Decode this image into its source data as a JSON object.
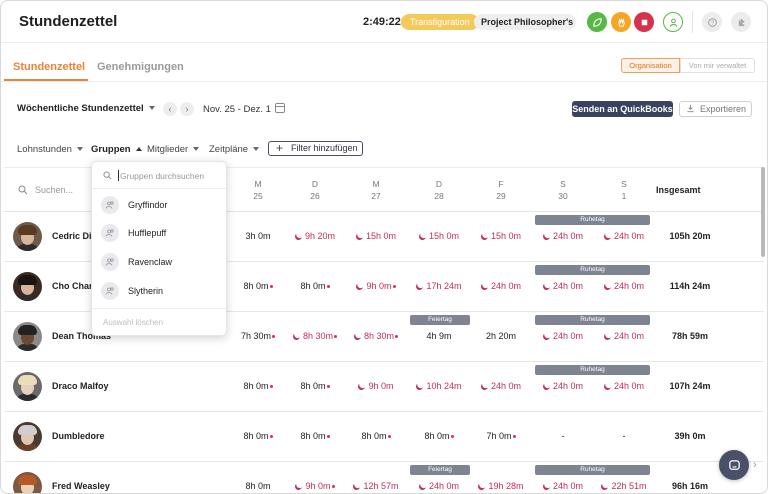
{
  "header": {
    "title": "Stundenzettel",
    "timer": "2:49:22",
    "activity_tag": "Transfiguration",
    "project_tag": "Project Philosopher's S...",
    "icons": [
      "leaf-icon",
      "hand-icon",
      "stop-icon",
      "user-icon",
      "help-icon",
      "puzzle-icon"
    ]
  },
  "tabs": {
    "active": "Stundenzettel",
    "inactive": "Genehmigungen"
  },
  "scope": {
    "organisation": "Organisation",
    "managed": "Von mir verwaltet"
  },
  "toolbar": {
    "sheet_type": "Wöchentliche Stundenzettel",
    "date_range": "Nov. 25 - Dez. 1",
    "quickbooks_label": "Senden an QuickBooks",
    "export_label": "Exportieren"
  },
  "filters": {
    "pay_hours": "Lohnstunden",
    "groups": "Gruppen",
    "members": "Mitglieder",
    "schedules": "Zeitpläne",
    "add_filter": "Filter hinzufügen"
  },
  "group_dropdown": {
    "search_placeholder": "Gruppen durchsuchen",
    "items": [
      "Gryffindor",
      "Hufflepuff",
      "Ravenclaw",
      "Slytherin"
    ],
    "clear": "Auswahl löschen"
  },
  "table": {
    "search_placeholder": "Suchen...",
    "days": [
      {
        "letter": "D",
        "num": "26"
      },
      {
        "letter": "M",
        "num": "25"
      },
      {
        "letter": "M",
        "num": "27"
      },
      {
        "letter": "D",
        "num": "28"
      },
      {
        "letter": "F",
        "num": "29"
      },
      {
        "letter": "S",
        "num": "30"
      },
      {
        "letter": "S",
        "num": "1"
      }
    ],
    "total_header": "Insgesamt",
    "rows": [
      {
        "name": "Cedric Dig",
        "cells": [
          "3h 0m",
          "9h 20m",
          "15h 0m",
          "15h 0m",
          "15h 0m",
          "24h 0m",
          "24h 0m"
        ],
        "total": "105h 20m"
      },
      {
        "name": "Cho Chang",
        "cells": [
          "8h 0m",
          "8h 0m",
          "9h 0m",
          "17h 24m",
          "24h 0m",
          "24h 0m",
          "24h 0m"
        ],
        "total": "114h 24m"
      },
      {
        "name": "Dean Thomas",
        "cells": [
          "7h 30m",
          "8h 30m",
          "8h 30m",
          "4h 9m",
          "2h 20m",
          "24h 0m",
          "24h 0m"
        ],
        "total": "78h 59m"
      },
      {
        "name": "Draco Malfoy",
        "cells": [
          "8h 0m",
          "8h 0m",
          "9h 0m",
          "10h 24m",
          "24h 0m",
          "24h 0m",
          "24h 0m"
        ],
        "total": "107h 24m"
      },
      {
        "name": "Dumbledore",
        "cells": [
          "8h 0m",
          "8h 0m",
          "8h 0m",
          "8h 0m",
          "7h 0m",
          "-",
          "-"
        ],
        "total": "39h 0m"
      },
      {
        "name": "Fred Weasley",
        "cells": [
          "8h 0m",
          "9h 0m",
          "12h 57m",
          "24h 0m",
          "19h 28m",
          "24h 0m",
          "22h 51m"
        ],
        "total": "96h 16m"
      }
    ],
    "pill_rest": "Ruhetag",
    "pill_holiday": "Feiertag"
  },
  "colors": {
    "accent": "#e8833a",
    "overtime": "#c22f55",
    "navy": "#3b4260"
  }
}
